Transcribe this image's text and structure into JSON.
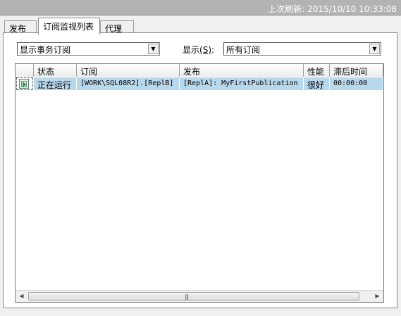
{
  "header": {
    "refresh_text": "上次刷新: 2015/10/10 10:33:08"
  },
  "tabs": [
    {
      "label": "发布",
      "active": false
    },
    {
      "label": "订阅监视列表",
      "active": true
    },
    {
      "label": "代理",
      "active": false
    }
  ],
  "filter": {
    "type_value": "显示事务订阅",
    "show_label_prefix": "显示",
    "show_label_hotkey": "(S)",
    "show_label_suffix": ":",
    "show_value": "所有订阅"
  },
  "grid": {
    "columns": [
      "",
      "状态",
      "订阅",
      "发布",
      "性能",
      "滞后时间"
    ],
    "rows": [
      {
        "icon": "running-subscription-icon",
        "status": "正在运行",
        "subscription": "[WORK\\SQL08R2].[ReplB]",
        "publication": "[ReplA]: MyFirstPublication",
        "performance": "很好",
        "latency": "00:00:00",
        "selected": true
      }
    ],
    "scrollbar_grip": "|||"
  },
  "colors": {
    "selection": "#b8d8ee",
    "titlebar": "#b3b3b3",
    "running_icon": "#1fa12a"
  }
}
